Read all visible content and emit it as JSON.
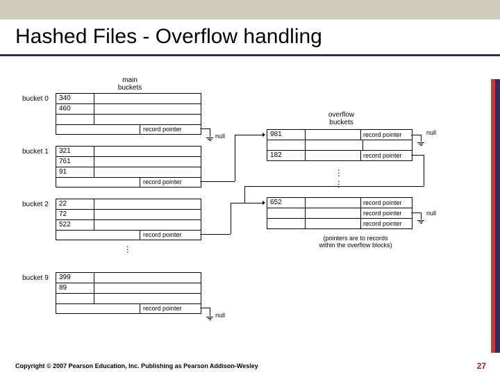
{
  "slide": {
    "title": "Hashed Files - Overflow handling",
    "footer": "Copyright © 2007 Pearson Education, Inc. Publishing as Pearson Addison-Wesley",
    "page_number": "27"
  },
  "labels": {
    "main_buckets": "main\nbuckets",
    "overflow_buckets": "overflow\nbuckets",
    "record_pointer": "record pointer",
    "null": "null",
    "pointers_note": "(pointers are to records\nwithin the overflow blocks)"
  },
  "diagram": {
    "buckets": [
      {
        "name": "bucket 0",
        "values": [
          "340",
          "460"
        ],
        "empty_rows": 1,
        "has_overflow": false
      },
      {
        "name": "bucket 1",
        "values": [
          "321",
          "761",
          "91"
        ],
        "empty_rows": 0,
        "has_overflow": true
      },
      {
        "name": "bucket 2",
        "values": [
          "22",
          "72",
          "522"
        ],
        "empty_rows": 0,
        "has_overflow": true
      },
      {
        "name": "bucket 9",
        "values": [
          "399",
          "89"
        ],
        "empty_rows": 1,
        "has_overflow": false
      }
    ],
    "overflow_blocks": [
      {
        "values": [
          "981",
          "",
          "182"
        ],
        "trailing": [
          "record pointer",
          "",
          "record pointer"
        ]
      },
      {
        "values": [
          "652"
        ],
        "trailing": [
          "record pointer",
          "record pointer",
          "record pointer"
        ],
        "empty_rows": 2
      }
    ]
  }
}
